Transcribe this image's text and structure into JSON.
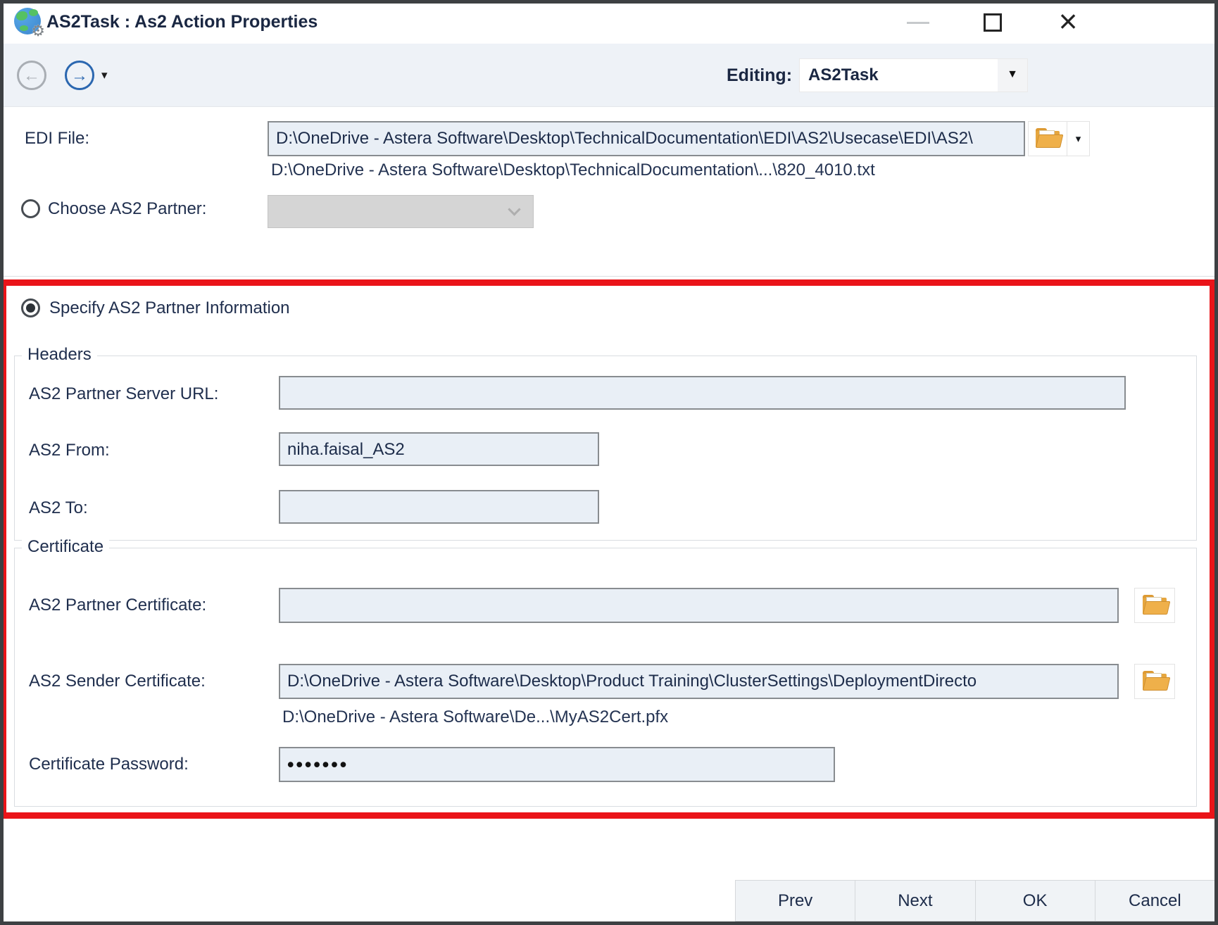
{
  "window": {
    "title": "AS2Task : As2 Action Properties"
  },
  "toolbar": {
    "editing_label": "Editing:",
    "editing_value": "AS2Task"
  },
  "edi_file": {
    "label": "EDI File:",
    "value": "D:\\OneDrive - Astera Software\\Desktop\\TechnicalDocumentation\\EDI\\AS2\\Usecase\\EDI\\AS2\\",
    "sub_path": "D:\\OneDrive - Astera Software\\Desktop\\TechnicalDocumentation\\...\\820_4010.txt"
  },
  "partner_choice": {
    "choose_label": "Choose AS2 Partner:",
    "choose_selected": false,
    "specify_label": "Specify AS2 Partner Information",
    "specify_selected": true
  },
  "headers_group": {
    "title": "Headers",
    "server_url": {
      "label": "AS2 Partner Server URL:",
      "value": ""
    },
    "as2_from": {
      "label": "AS2 From:",
      "value": "niha.faisal_AS2"
    },
    "as2_to": {
      "label": "AS2 To:",
      "value": ""
    }
  },
  "certificate_group": {
    "title": "Certificate",
    "partner_cert": {
      "label": "AS2 Partner Certificate:",
      "value": ""
    },
    "sender_cert": {
      "label": "AS2 Sender Certificate:",
      "value": "D:\\OneDrive - Astera Software\\Desktop\\Product Training\\ClusterSettings\\DeploymentDirecto",
      "sub_path": "D:\\OneDrive - Astera Software\\De...\\MyAS2Cert.pfx"
    },
    "password": {
      "label": "Certificate Password:",
      "value": "•••••••"
    }
  },
  "footer": {
    "buttons": [
      "Prev",
      "Next",
      "OK",
      "Cancel"
    ]
  },
  "icons": [
    "globe-app-icon",
    "gear-icon",
    "back-arrow-icon",
    "forward-arrow-icon",
    "dropdown-caret-icon",
    "folder-open-icon",
    "chevron-down-icon",
    "minimize-icon",
    "maximize-icon",
    "close-icon"
  ],
  "colors": {
    "annotation_red": "#ea1419",
    "accent_blue": "#2b67b0",
    "label_navy": "#202f4e",
    "input_bg": "#e9eff6",
    "toolbar_bg": "#eef2f7",
    "disabled_combo_bg": "#d5d5d5",
    "folder_amber": "#e6a63e"
  }
}
